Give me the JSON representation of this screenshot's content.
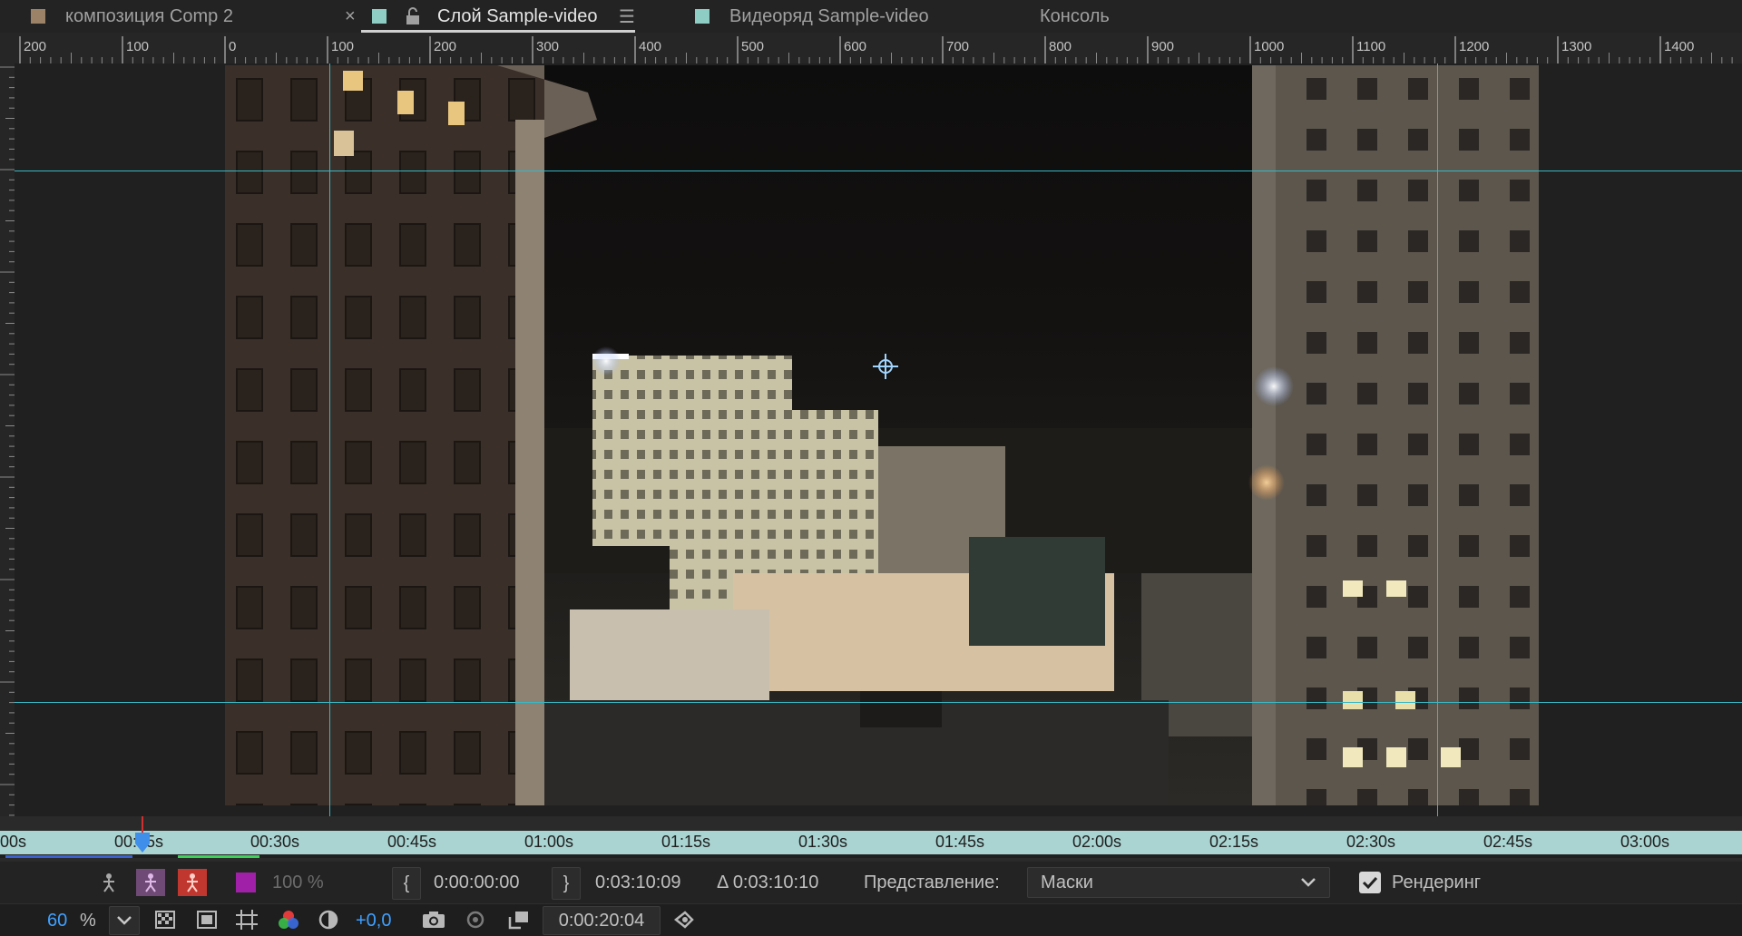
{
  "tabs": [
    {
      "label": "композиция Comp 2",
      "close": "×",
      "swatch_color": "#9c8368"
    },
    {
      "label": "Слой Sample-video",
      "menu": "☰",
      "swatch_color": "#8ecdc4",
      "lock_icon": "lock-open-icon",
      "active": true
    },
    {
      "label": "Видеоряд Sample-video",
      "swatch_color": "#8ecdc4"
    },
    {
      "label": "Консоль"
    }
  ],
  "ruler": {
    "labels": [
      "200",
      "100",
      "0",
      "100",
      "200",
      "300",
      "400",
      "500",
      "600",
      "700",
      "800",
      "900",
      "1000",
      "1100",
      "1200",
      "1300",
      "1400"
    ]
  },
  "guides": {
    "color": "#39b7c4"
  },
  "timeline": {
    "labels": [
      "00s",
      "00:15s",
      "00:30s",
      "00:45s",
      "01:00s",
      "01:15s",
      "01:30s",
      "01:45s",
      "02:00s",
      "02:15s",
      "02:30s",
      "02:45s",
      "03:00s"
    ],
    "playhead_fraction": 0.082,
    "strip_color": "#a9d4d2"
  },
  "controls": {
    "opacity": "100 %",
    "in_icon": "{",
    "in_time": "0:00:00:00",
    "out_icon": "}",
    "out_time": "0:03:10:09",
    "duration": "Δ 0:03:10:10",
    "view_label": "Представление:",
    "view_value": "Маски",
    "render_label": "Рендеринг",
    "render_checked": true,
    "zoom_value": "60",
    "zoom_unit": "%",
    "exposure": "+0,0",
    "current_time": "0:00:20:04"
  }
}
